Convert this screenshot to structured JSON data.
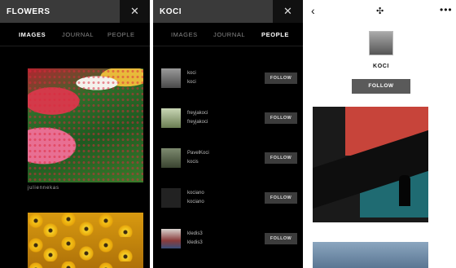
{
  "screens": [
    {
      "search_text": "FLOWERS",
      "close_glyph": "✕",
      "tabs": [
        {
          "label": "IMAGES",
          "active": true
        },
        {
          "label": "JOURNAL",
          "active": false
        },
        {
          "label": "PEOPLE",
          "active": false
        }
      ],
      "images": [
        {
          "icon": "tulip-field-photo",
          "caption": "juliennekas"
        },
        {
          "icon": "sunflower-field-photo",
          "caption": ""
        }
      ]
    },
    {
      "search_text": "KOCI",
      "close_glyph": "✕",
      "tabs": [
        {
          "label": "IMAGES",
          "active": false
        },
        {
          "label": "JOURNAL",
          "active": false
        },
        {
          "label": "PEOPLE",
          "active": true
        }
      ],
      "people": [
        {
          "username": "koci",
          "name": "koci",
          "follow_label": "FOLLOW"
        },
        {
          "username": "freyjakoci",
          "name": "freyjakoci",
          "follow_label": "FOLLOW"
        },
        {
          "username": "PavelKoci",
          "name": "kocis",
          "follow_label": "FOLLOW"
        },
        {
          "username": "kociano",
          "name": "kociano",
          "follow_label": "FOLLOW"
        },
        {
          "username": "kledis3",
          "name": "kledis3",
          "follow_label": "FOLLOW"
        }
      ]
    },
    {
      "back_glyph": "‹",
      "logo_icon": "vsco-logo-icon",
      "logo_glyph": "✣",
      "more_glyph": "•••",
      "profile_name": "KOCI",
      "follow_label": "FOLLOW"
    }
  ],
  "colors": {
    "dark_bg": "#000000",
    "search_field": "#3a3a3a",
    "follow_button": "#3c3c3c",
    "profile_follow": "#5a5a5a"
  }
}
